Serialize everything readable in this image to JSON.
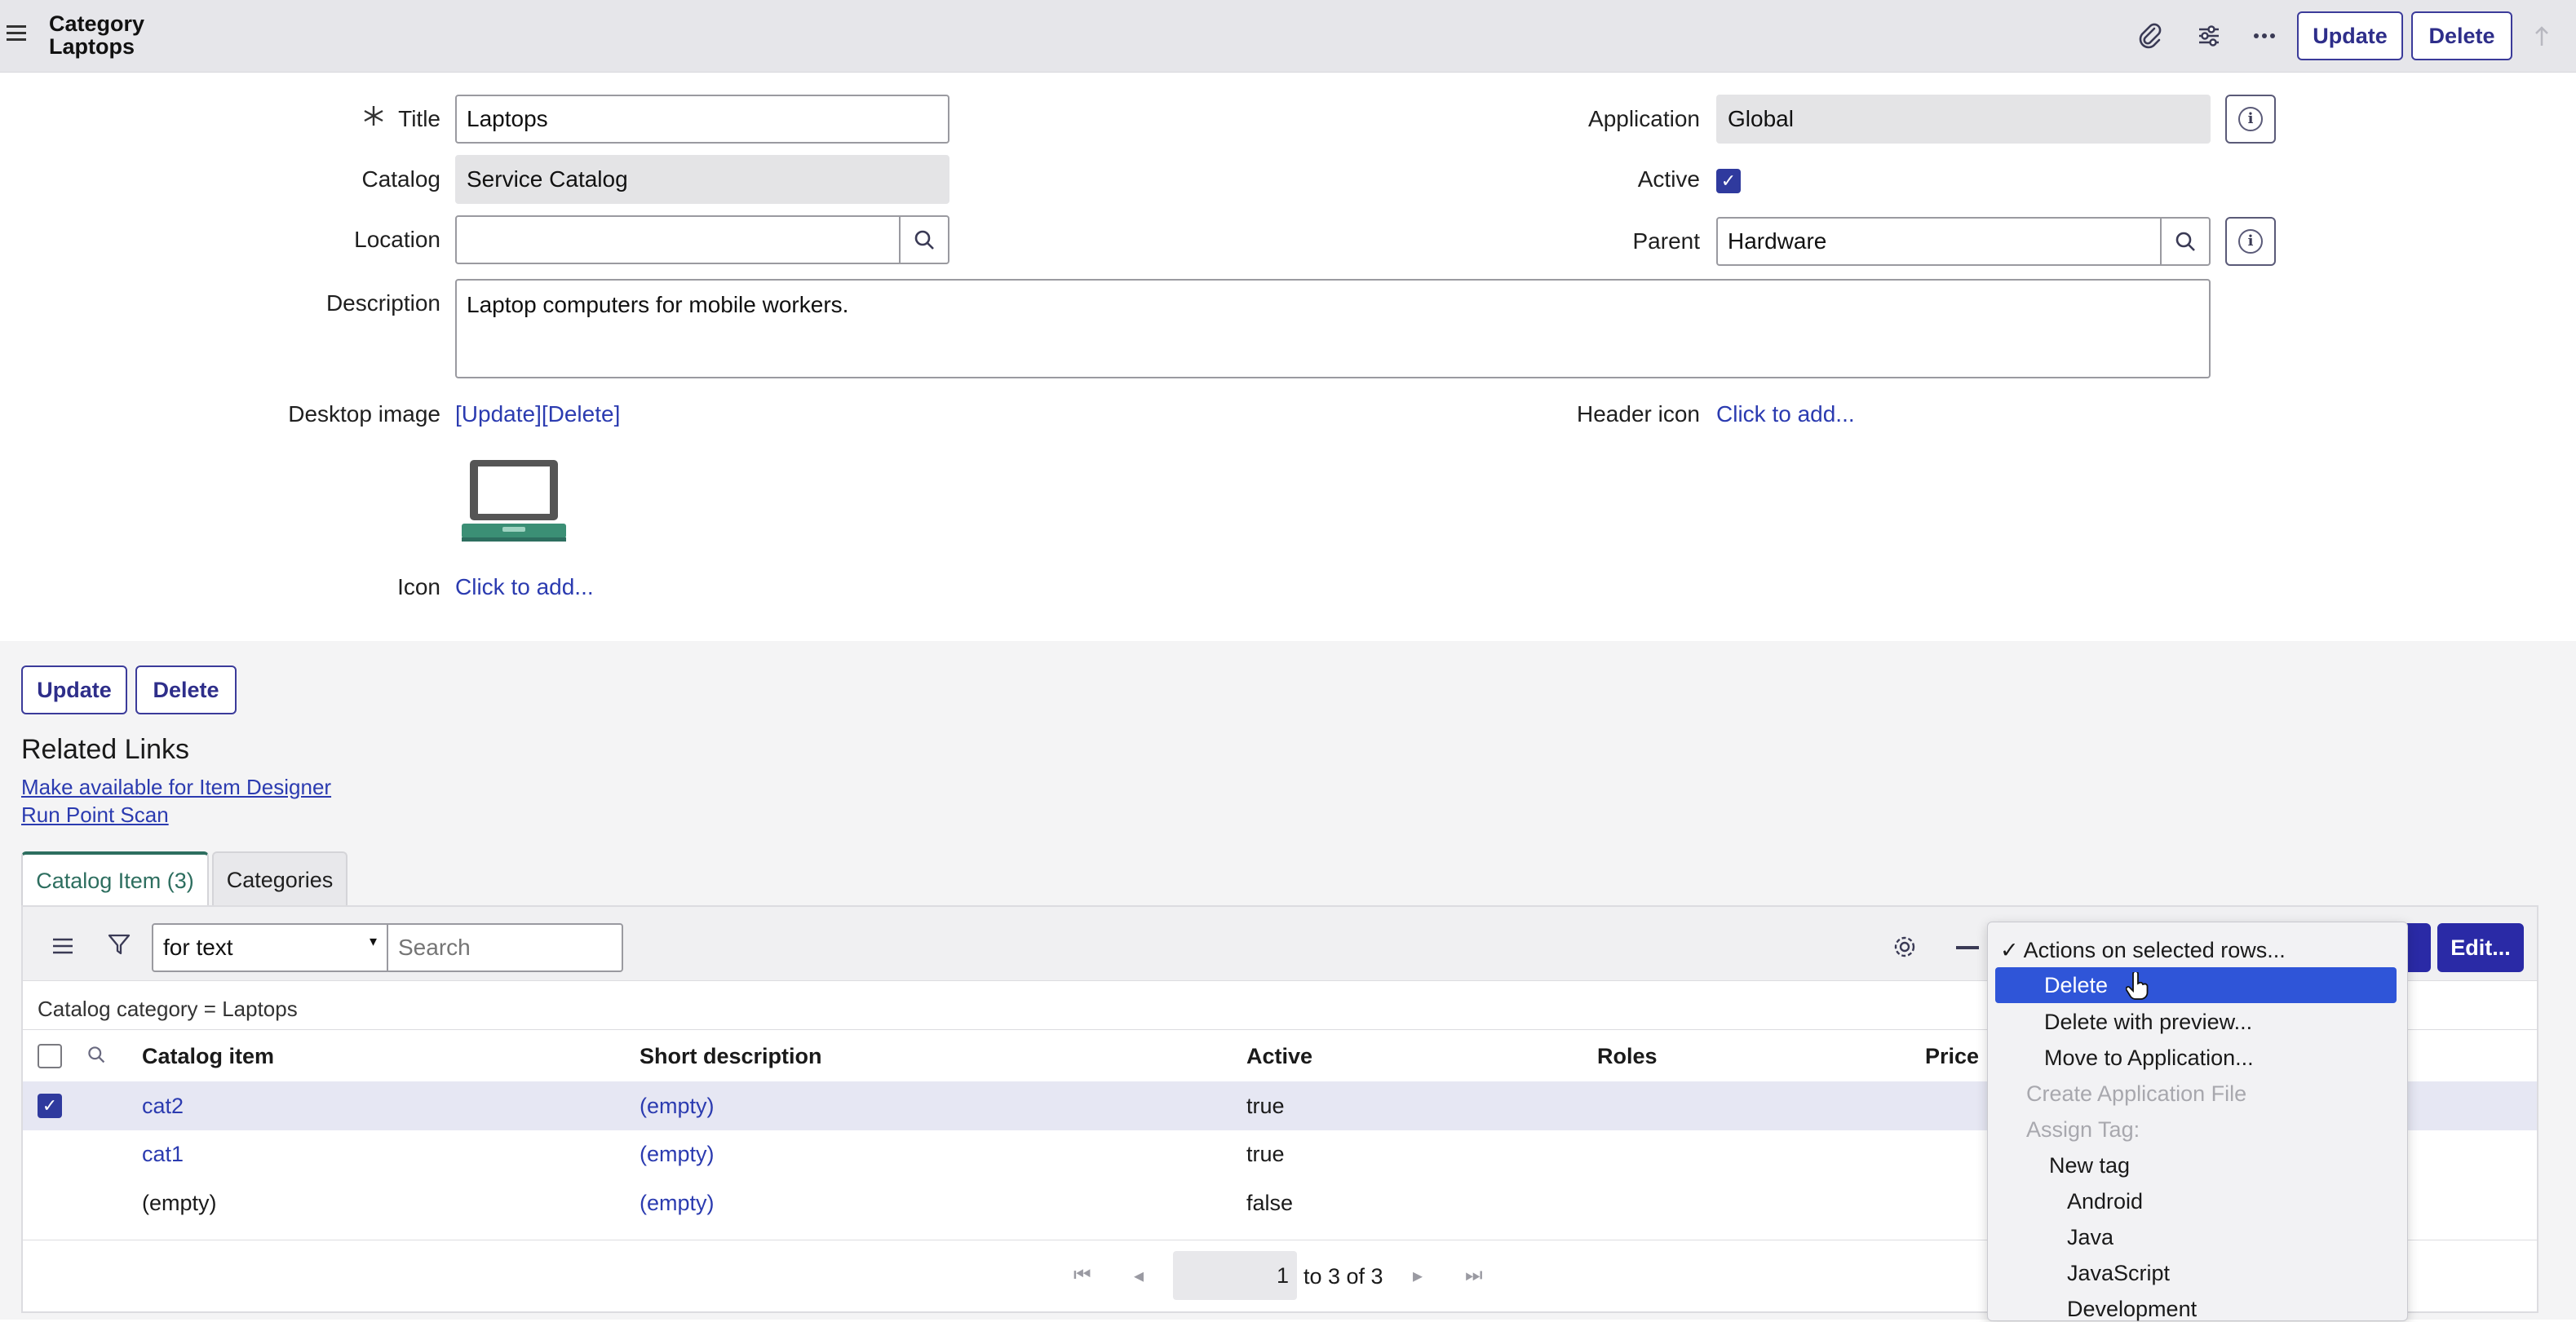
{
  "header": {
    "crumb_line1": "Category",
    "crumb_line2": "Laptops",
    "update_label": "Update",
    "delete_label": "Delete"
  },
  "form": {
    "title_label": "Title",
    "title_value": "Laptops",
    "catalog_label": "Catalog",
    "catalog_value": "Service Catalog",
    "location_label": "Location",
    "location_value": "",
    "description_label": "Description",
    "description_value": "Laptop computers for mobile workers.",
    "desktop_image_label": "Desktop image",
    "desktop_image_update": "[Update]",
    "desktop_image_delete": "[Delete]",
    "icon_label": "Icon",
    "icon_link": "Click to add...",
    "application_label": "Application",
    "application_value": "Global",
    "active_label": "Active",
    "active_checked": true,
    "parent_label": "Parent",
    "parent_value": "Hardware",
    "header_icon_label": "Header icon",
    "header_icon_link": "Click to add..."
  },
  "bottom_buttons": {
    "update_label": "Update",
    "delete_label": "Delete"
  },
  "related_links": {
    "title": "Related Links",
    "items": [
      "Make available for Item Designer",
      "Run Point Scan"
    ]
  },
  "tabs": [
    {
      "label": "Catalog Item (3)",
      "active": true
    },
    {
      "label": "Categories",
      "active": false
    }
  ],
  "list": {
    "search_field_option": "for text",
    "search_placeholder": "Search",
    "filter_breadcrumb": "Catalog category = Laptops",
    "edit_button": "Edit...",
    "new_button_partial": "v",
    "columns": [
      "Catalog item",
      "Short description",
      "Active",
      "Roles",
      "Price"
    ],
    "rows": [
      {
        "catalog_item": "cat2",
        "short_description": "(empty)",
        "active": "true",
        "selected": true
      },
      {
        "catalog_item": "cat1",
        "short_description": "(empty)",
        "active": "true",
        "selected": false
      },
      {
        "catalog_item": "(empty)",
        "short_description": "(empty)",
        "active": "false",
        "selected": false
      }
    ],
    "pager": {
      "page": "1",
      "range": "to 3 of 3"
    }
  },
  "actions_menu": {
    "header": "Actions on selected rows...",
    "items": [
      {
        "label": "Delete",
        "state": "highlighted"
      },
      {
        "label": "Delete with preview...",
        "state": "normal"
      },
      {
        "label": "Move to Application...",
        "state": "normal"
      },
      {
        "label": "Create Application File",
        "state": "disabled"
      },
      {
        "label": "Assign Tag:",
        "state": "disabled"
      },
      {
        "label": "New tag",
        "state": "normal"
      },
      {
        "label": "Android",
        "state": "normal"
      },
      {
        "label": "Java",
        "state": "normal"
      },
      {
        "label": "JavaScript",
        "state": "normal"
      },
      {
        "label": "Development",
        "state": "normal"
      }
    ]
  },
  "colors": {
    "brand_button": "#2a2aa6",
    "link": "#2b3bb0",
    "tab_active": "#2d6e5f",
    "menu_highlight": "#2f55d8"
  }
}
